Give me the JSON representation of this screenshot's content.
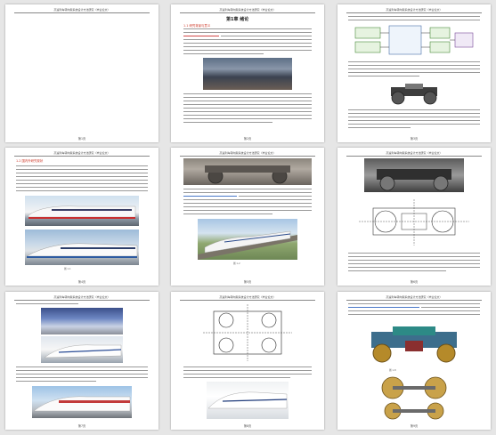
{
  "document": {
    "running_header": "高速列车转向架系统设计方法研究（毕业论文）",
    "pages": [
      {
        "page_number": "第1页"
      },
      {
        "page_number": "第2页",
        "chapter_title": "第1章 绪论",
        "section_title": "1.1 研究背景与意义"
      },
      {
        "page_number": "第3页"
      },
      {
        "page_number": "第4页",
        "section_title": "1.2 国内外研究现状"
      },
      {
        "page_number": "第5页"
      },
      {
        "page_number": "第6页"
      },
      {
        "page_number": "第7页"
      },
      {
        "page_number": "第8页"
      },
      {
        "page_number": "第9页"
      }
    ]
  }
}
